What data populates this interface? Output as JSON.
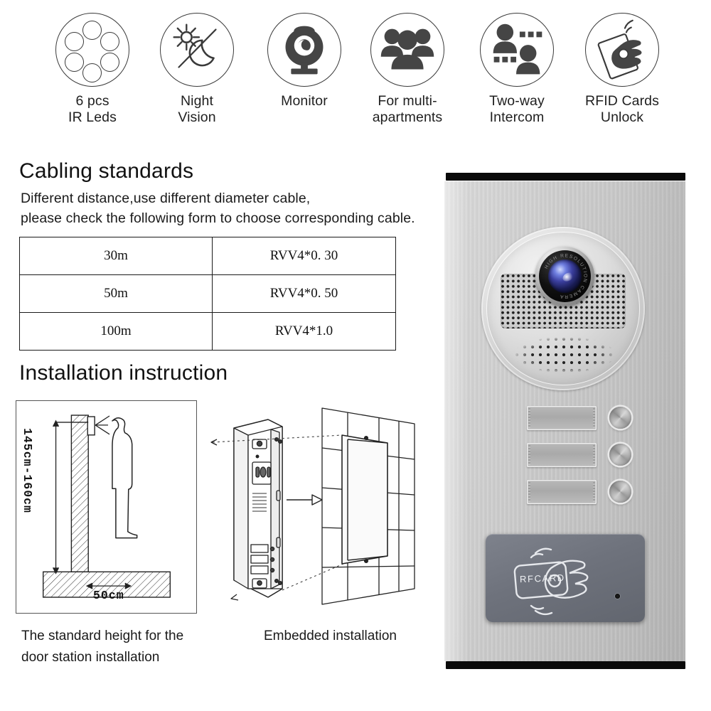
{
  "features": [
    {
      "icon": "ir-leds-icon",
      "label": "6 pcs\nIR Leds"
    },
    {
      "icon": "night-vision-icon",
      "label": "Night\nVision"
    },
    {
      "icon": "monitor-camera-icon",
      "label": "Monitor"
    },
    {
      "icon": "multi-apartments-icon",
      "label": "For multi-\napartments"
    },
    {
      "icon": "two-way-intercom-icon",
      "label": "Two-way\nIntercom"
    },
    {
      "icon": "rfid-card-icon",
      "label": "RFID Cards\nUnlock"
    }
  ],
  "cabling": {
    "heading": "Cabling standards",
    "intro_line1": "Different distance,use different diameter cable,",
    "intro_line2": "please check the following form to choose corresponding cable.",
    "rows": [
      {
        "distance": "30m",
        "cable": "RVV4*0. 30"
      },
      {
        "distance": "50m",
        "cable": "RVV4*0. 50"
      },
      {
        "distance": "100m",
        "cable": "RVV4*1.0"
      }
    ]
  },
  "installation": {
    "heading": "Installation instruction",
    "height_label": "145cm-160cm",
    "distance_label": "50cm",
    "caption_left_line1": "The standard height for the",
    "caption_left_line2": "door station installation",
    "caption_right": "Embedded installation"
  },
  "product": {
    "lens_engraving": "HIGH RESOLUTION CAMERA",
    "rfid_label": "RFCARD",
    "call_buttons": 3,
    "colors": {
      "panel": "#cdcdcd",
      "trim_bar": "#0a0a0a",
      "rfid_panel": "#6e727c",
      "lens_blue": "#3b3f9e"
    }
  },
  "palette": {
    "text": "#1a1a1a",
    "icon_stroke": "#3a3a3a",
    "icon_fill": "#454545",
    "table_border": "#1a1a1a",
    "diagram_stroke": "#333333"
  }
}
